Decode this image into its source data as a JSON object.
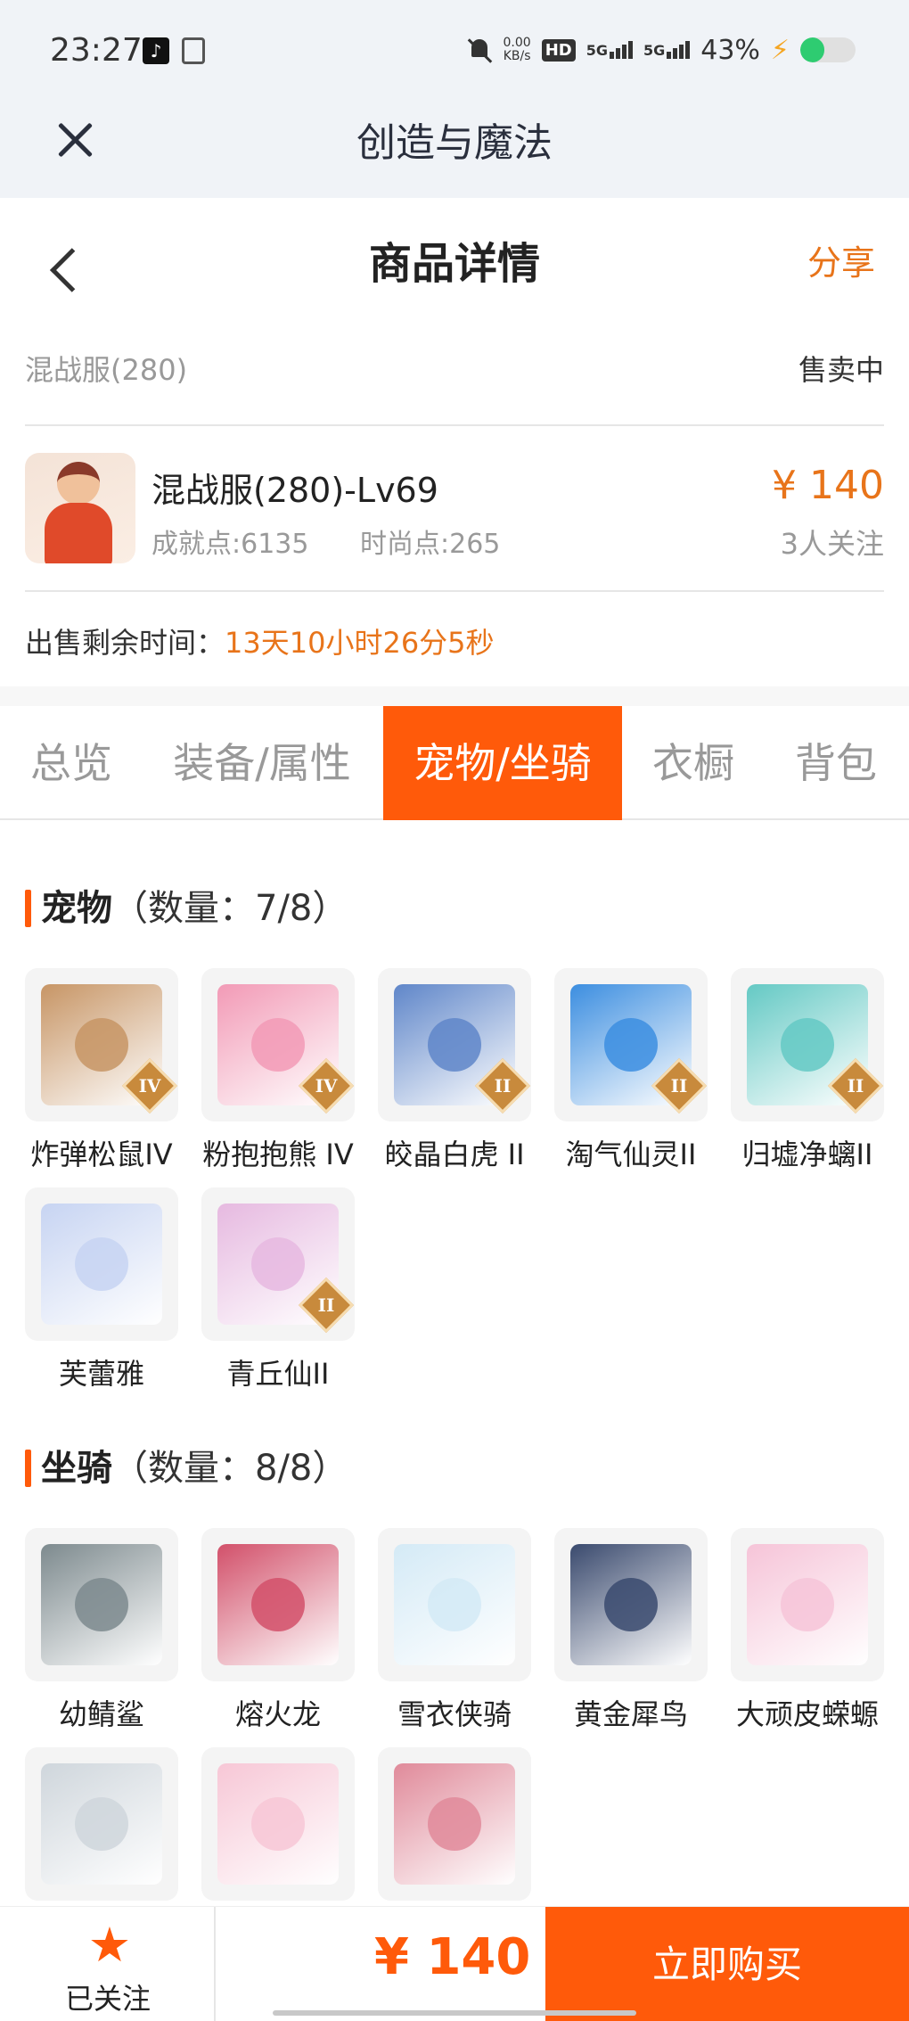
{
  "status_bar": {
    "time": "23:27",
    "net_speed_value": "0.00",
    "net_speed_unit": "KB/s",
    "hd_badge": "HD",
    "signal1": "5G",
    "signal2": "5G",
    "battery_percent": "43%",
    "battery_level": 0.43
  },
  "app_bar": {
    "title": "创造与魔法"
  },
  "header": {
    "title": "商品详情",
    "share_label": "分享"
  },
  "server": {
    "name": "混战服(280)",
    "status": "售卖中"
  },
  "product": {
    "name": "混战服(280)-Lv69",
    "achievement": "成就点:6135",
    "fashion": "时尚点:265",
    "price": "¥ 140",
    "followers": "3人关注"
  },
  "remaining": {
    "label": "出售剩余时间：",
    "value": "13天10小时26分5秒"
  },
  "tabs": [
    {
      "label": "总览"
    },
    {
      "label": "装备/属性"
    },
    {
      "label": "宠物/坐骑"
    },
    {
      "label": "衣橱"
    },
    {
      "label": "背包"
    }
  ],
  "pets": {
    "title": "宠物",
    "count": "（数量：7/8）",
    "items": [
      {
        "name": "炸弹松鼠IV",
        "tier": "IV",
        "color": "#c79565"
      },
      {
        "name": "粉抱抱熊 IV",
        "tier": "IV",
        "color": "#f29ab6"
      },
      {
        "name": "皎晶白虎 II",
        "tier": "II",
        "color": "#5f86c9"
      },
      {
        "name": "淘气仙灵II",
        "tier": "II",
        "color": "#3c8ee0"
      },
      {
        "name": "归墟净螭II",
        "tier": "II",
        "color": "#64c9c4"
      },
      {
        "name": "芙蕾雅",
        "tier": "",
        "color": "#c7d4f2"
      },
      {
        "name": "青丘仙II",
        "tier": "II",
        "color": "#e6b9e0"
      }
    ]
  },
  "mounts": {
    "title": "坐骑",
    "count": "（数量：8/8）",
    "items": [
      {
        "name": "幼鲭鲨",
        "color": "#7d8a8e"
      },
      {
        "name": "熔火龙",
        "color": "#d2506a"
      },
      {
        "name": "雪衣侠骑",
        "color": "#d4eaf6"
      },
      {
        "name": "黄金犀鸟",
        "color": "#3a4a6e"
      },
      {
        "name": "大顽皮蝾螈",
        "color": "#f6c4d8"
      },
      {
        "name": "",
        "color": "#cfd6dc"
      },
      {
        "name": "",
        "color": "#f7c7d6"
      },
      {
        "name": "",
        "color": "#e08a9a"
      }
    ]
  },
  "bottom_bar": {
    "follow_label": "已关注",
    "price": "¥ 140",
    "buy_label": "立即购买"
  },
  "colors": {
    "accent": "#ff5a0a",
    "price": "#e8741a"
  }
}
